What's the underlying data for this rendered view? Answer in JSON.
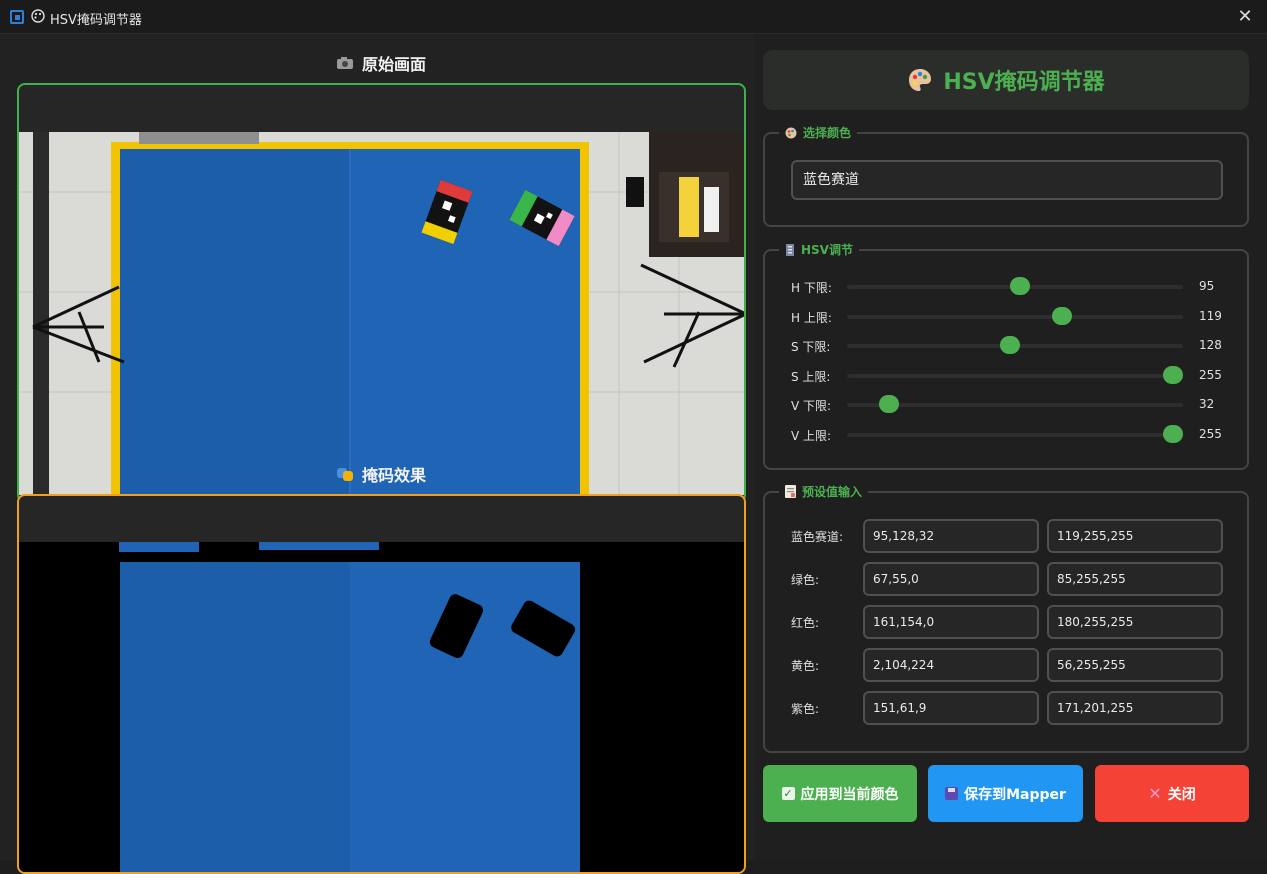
{
  "window": {
    "title": "HSV掩码调节器",
    "close_glyph": "✕"
  },
  "left": {
    "original_title": "原始画面",
    "mask_title": "掩码效果"
  },
  "header": {
    "title": "HSV掩码调节器"
  },
  "color_group": {
    "label": "选择颜色",
    "selected": "蓝色赛道"
  },
  "hsv_group": {
    "label": "HSV调节",
    "sliders": [
      {
        "label": "H 下限:",
        "value": "95",
        "fraction": 0.53
      },
      {
        "label": "H 上限:",
        "value": "119",
        "fraction": 0.66
      },
      {
        "label": "S 下限:",
        "value": "128",
        "fraction": 0.5
      },
      {
        "label": "S 上限:",
        "value": "255",
        "fraction": 1.0
      },
      {
        "label": "V 下限:",
        "value": "32",
        "fraction": 0.13
      },
      {
        "label": "V 上限:",
        "value": "255",
        "fraction": 1.0
      }
    ]
  },
  "preset_group": {
    "label": "预设值输入",
    "rows": [
      {
        "label": "蓝色赛道:",
        "lower": "95,128,32",
        "upper": "119,255,255"
      },
      {
        "label": "绿色:",
        "lower": "67,55,0",
        "upper": "85,255,255"
      },
      {
        "label": "红色:",
        "lower": "161,154,0",
        "upper": "180,255,255"
      },
      {
        "label": "黄色:",
        "lower": "2,104,224",
        "upper": "56,255,255"
      },
      {
        "label": "紫色:",
        "lower": "151,61,9",
        "upper": "171,201,255"
      }
    ]
  },
  "buttons": {
    "apply": "应用到当前颜色",
    "save": "保存到Mapper",
    "close": "关闭"
  },
  "colors": {
    "accent_green": "#4caf50",
    "accent_blue": "#2196f3",
    "accent_red": "#f44336",
    "frame_orange": "#f0a020"
  }
}
